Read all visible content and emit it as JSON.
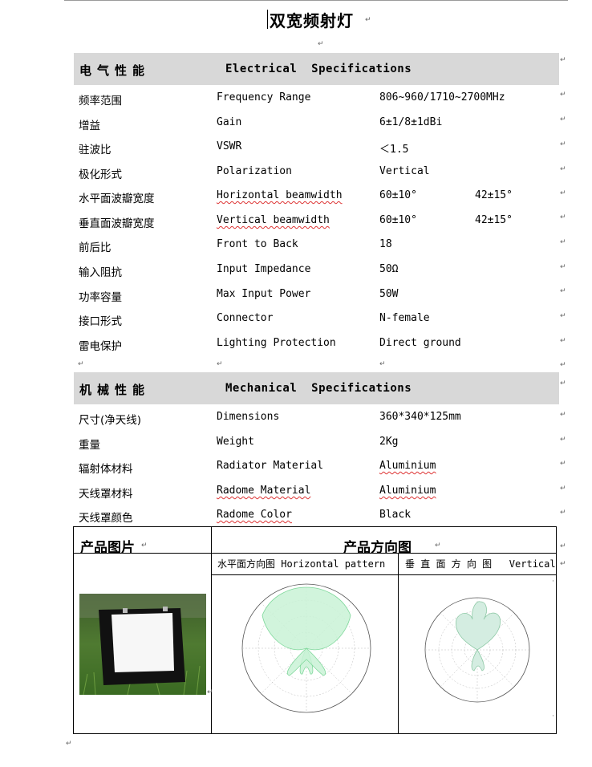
{
  "title": "双宽频射灯",
  "electrical": {
    "header_cn": "电气性能",
    "header_en": "Electrical  Specifications",
    "rows": [
      {
        "cn": "频率范围",
        "en": "Frequency Range",
        "val": "806~960/1710~2700MHz",
        "val2": ""
      },
      {
        "cn": "增益",
        "en": "Gain",
        "val": "6±1/8±1dBi",
        "val2": ""
      },
      {
        "cn": "驻波比",
        "en": "VSWR",
        "val": "＜1.5",
        "val2": ""
      },
      {
        "cn": "极化形式",
        "en": "Polarization",
        "val": "Vertical",
        "val2": ""
      },
      {
        "cn": "水平面波瓣宽度",
        "en": "Horizontal beamwidth",
        "val": "60±10°",
        "val2": "42±15°"
      },
      {
        "cn": "垂直面波瓣宽度",
        "en": "Vertical beamwidth",
        "val": "60±10°",
        "val2": "42±15°"
      },
      {
        "cn": "前后比",
        "en": "Front to Back",
        "val": "18",
        "val2": ""
      },
      {
        "cn": "输入阻抗",
        "en": "Input Impedance",
        "val": "50Ω",
        "val2": ""
      },
      {
        "cn": "功率容量",
        "en": "Max Input Power",
        "val": "50W",
        "val2": ""
      },
      {
        "cn": "接口形式",
        "en": "Connector",
        "val": "N-female",
        "val2": ""
      },
      {
        "cn": "雷电保护",
        "en": "Lighting Protection",
        "val": "Direct ground",
        "val2": ""
      }
    ]
  },
  "mechanical": {
    "header_cn": "机械性能",
    "header_en": "Mechanical  Specifications",
    "rows": [
      {
        "cn": "尺寸(净天线)",
        "en": "Dimensions",
        "val": "360*340*125mm"
      },
      {
        "cn": "重量",
        "en": "Weight",
        "val": "2Kg"
      },
      {
        "cn": "辐射体材料",
        "en": "Radiator Material",
        "val": "Aluminium"
      },
      {
        "cn": "天线罩材料",
        "en": "Radome Material",
        "val": "Aluminium"
      },
      {
        "cn": "天线罩颜色",
        "en": "Radome Color",
        "val": "Black"
      }
    ]
  },
  "product": {
    "picture_label": "产品图片",
    "pattern_label": "产品方向图",
    "horizontal_label": "水平面方向图 Horizontal pattern",
    "vertical_label": "垂 直 面 方 向 图   Vertical"
  },
  "colors": {
    "band": "#d8d8d8",
    "pattern_fill": "#c9f2d6",
    "pattern_stroke": "#7fd89b",
    "pattern_fill2": "#d4ede1",
    "grid": "#bbbbbb"
  }
}
